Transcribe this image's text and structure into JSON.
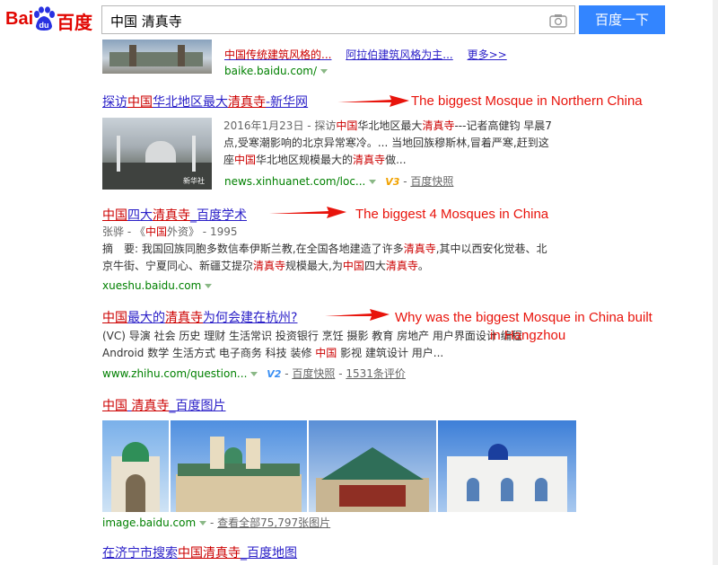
{
  "logo": {
    "text_a": "Bai",
    "text_b": "du",
    "text_c": "百度"
  },
  "search": {
    "query": "中国 清真寺",
    "button": "百度一下"
  },
  "top": {
    "links": [
      "中国传统建筑风格的...",
      "阿拉伯建筑风格为主...",
      "更多>>"
    ],
    "url": "baike.baidu.com/"
  },
  "r1": {
    "title": [
      "探访",
      "中国",
      "华北地区最大",
      "清真寺",
      "-新华网"
    ],
    "snippet": [
      [
        "2016年1月23日 - 探访",
        "中国",
        "华北地区最大",
        "清真寺",
        "---记者高健钧 早晨7"
      ],
      [
        "点,受寒潮影响的北京异常寒冷。... 当地回族穆斯林,冒着严寒,赶到这"
      ],
      [
        "座",
        "中国",
        "华北地区规模最大的",
        "清真寺",
        "做..."
      ]
    ],
    "url": "news.xinhuanet.com/loc...",
    "badge": "V3",
    "cache": "百度快照",
    "annotation": "The biggest Mosque in Northern China",
    "thumb_caption": "新华社"
  },
  "r2": {
    "title": [
      "中国",
      "四大",
      "清真寺",
      "_百度学术"
    ],
    "author": [
      "张骅 - 《",
      "中国",
      "外资》 - 1995"
    ],
    "snippet": [
      [
        "摘　要: 我国回族同胞多数信奉伊斯兰教,在全国各地建造了许多",
        "清真寺",
        ",其中以西安化觉巷、北"
      ],
      [
        "京牛街、宁夏同心、新疆艾提尕",
        "清真寺",
        "规模最大,为",
        "中国",
        "四大",
        "清真寺",
        "。"
      ]
    ],
    "url": "xueshu.baidu.com",
    "annotation": "The biggest 4 Mosques in China"
  },
  "r3": {
    "title": [
      "中国",
      "最大的",
      "清真寺",
      "为何会建在杭州?"
    ],
    "tags": "(VC) 导演 社会 历史 理财 生活常识 投资银行 烹饪 摄影 教育 房地产 用户界面设计 编程",
    "tags2": [
      "Android 数学 生活方式 电子商务 科技 装修 ",
      "中国",
      " 影视 建筑设计 用户..."
    ],
    "url": "www.zhihu.com/question...",
    "badge": "V2",
    "cache": "百度快照",
    "reviews": "1531条评价",
    "annotation": "Why was the biggest Mosque in China built",
    "annotation2": "in Hangzhou"
  },
  "r4": {
    "title": [
      "中国",
      " ",
      "清真寺",
      "_百度图片"
    ],
    "url": "image.baidu.com",
    "more": "查看全部75,797张图片"
  },
  "r5": {
    "title": [
      "在济宁市搜索",
      "中国",
      "清真寺",
      "_百度地图"
    ]
  },
  "colors": {
    "link": "#2b20c8",
    "highlight": "#cc0000",
    "url_green": "#008000",
    "annotation": "#e8140c",
    "button": "#3385ff"
  }
}
